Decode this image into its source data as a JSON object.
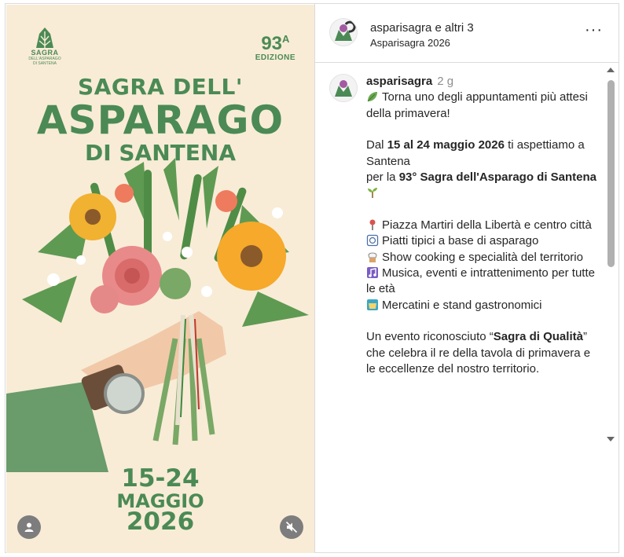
{
  "poster": {
    "logo_line1": "SAGRA",
    "logo_line2": "DELL'ASPARAGO",
    "logo_line3": "DI SANTENA",
    "edition_number": "93",
    "edition_sup": "A",
    "edition_label": "EDIZIONE",
    "title_line1": "SAGRA DELL'",
    "title_line2": "ASPARAGO",
    "title_line3": "DI SANTENA",
    "dates_line1": "15-24",
    "dates_line2": "MAGGIO",
    "dates_line3": "2026",
    "icons": {
      "user": "user-icon",
      "mute": "speaker-muted-icon"
    }
  },
  "header": {
    "account": "asparisagra e altri 3",
    "subtitle": "Asparisagra 2026",
    "more": "···"
  },
  "comment": {
    "username": "asparisagra",
    "time": "2 g",
    "intro": "Torna uno degli appuntamenti più attesi della primavera!",
    "p2_a": "Dal ",
    "p2_dates": "15 al 24 maggio 2026",
    "p2_b": " ti aspettiamo a Santena",
    "p2_c": "per la ",
    "p2_event": "93° Sagra dell'Asparago di Santena",
    "item1": "Piazza Martiri della Libertà e centro città",
    "item2": "Piatti tipici a base di asparago",
    "item3": "Show cooking e specialità del territorio",
    "item4": "Musica, eventi e intrattenimento per tutte le età",
    "item5": "Mercatini e stand gastronomici",
    "p4_a": "Un evento riconosciuto “",
    "p4_b": "Sagra di Qualità",
    "p4_c": "” che celebra il re della tavola di primavera e le eccellenze del nostro territorio."
  },
  "colors": {
    "poster_bg": "#f8ecd7",
    "poster_green": "#4b8a55",
    "text": "#262626",
    "muted": "#8e8e8e"
  }
}
